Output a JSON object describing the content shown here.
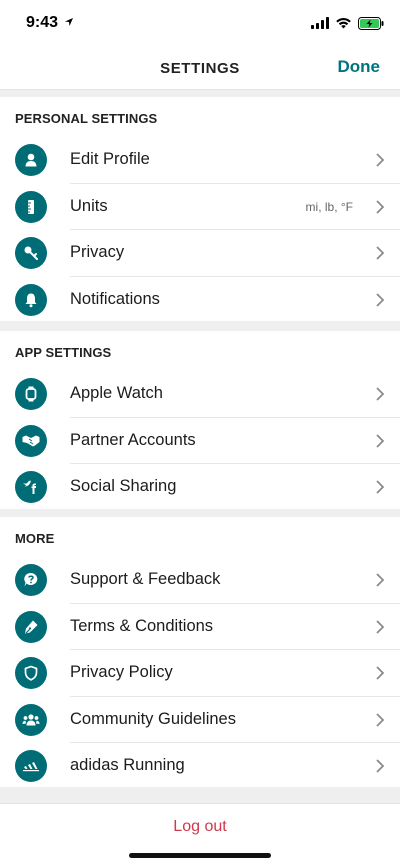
{
  "status": {
    "time": "9:43"
  },
  "nav": {
    "title": "SETTINGS",
    "done_label": "Done"
  },
  "colors": {
    "accent": "#00747e",
    "icon_bg": "#006d76",
    "logout": "#d0384b",
    "battery_green": "#34c759"
  },
  "sections": [
    {
      "header": "PERSONAL SETTINGS",
      "items": [
        {
          "label": "Edit Profile",
          "icon": "user-icon"
        },
        {
          "label": "Units",
          "icon": "ruler-icon",
          "detail": "mi, lb, °F"
        },
        {
          "label": "Privacy",
          "icon": "key-icon"
        },
        {
          "label": "Notifications",
          "icon": "bell-icon"
        }
      ]
    },
    {
      "header": "APP SETTINGS",
      "items": [
        {
          "label": "Apple Watch",
          "icon": "watch-icon"
        },
        {
          "label": "Partner Accounts",
          "icon": "handshake-icon"
        },
        {
          "label": "Social Sharing",
          "icon": "social-icon"
        }
      ]
    },
    {
      "header": "MORE",
      "items": [
        {
          "label": "Support & Feedback",
          "icon": "question-bubble-icon"
        },
        {
          "label": "Terms & Conditions",
          "icon": "pen-icon"
        },
        {
          "label": "Privacy Policy",
          "icon": "shield-icon"
        },
        {
          "label": "Community Guidelines",
          "icon": "group-icon"
        },
        {
          "label": "adidas Running",
          "icon": "adidas-logo-icon"
        }
      ]
    }
  ],
  "logout_label": "Log out"
}
